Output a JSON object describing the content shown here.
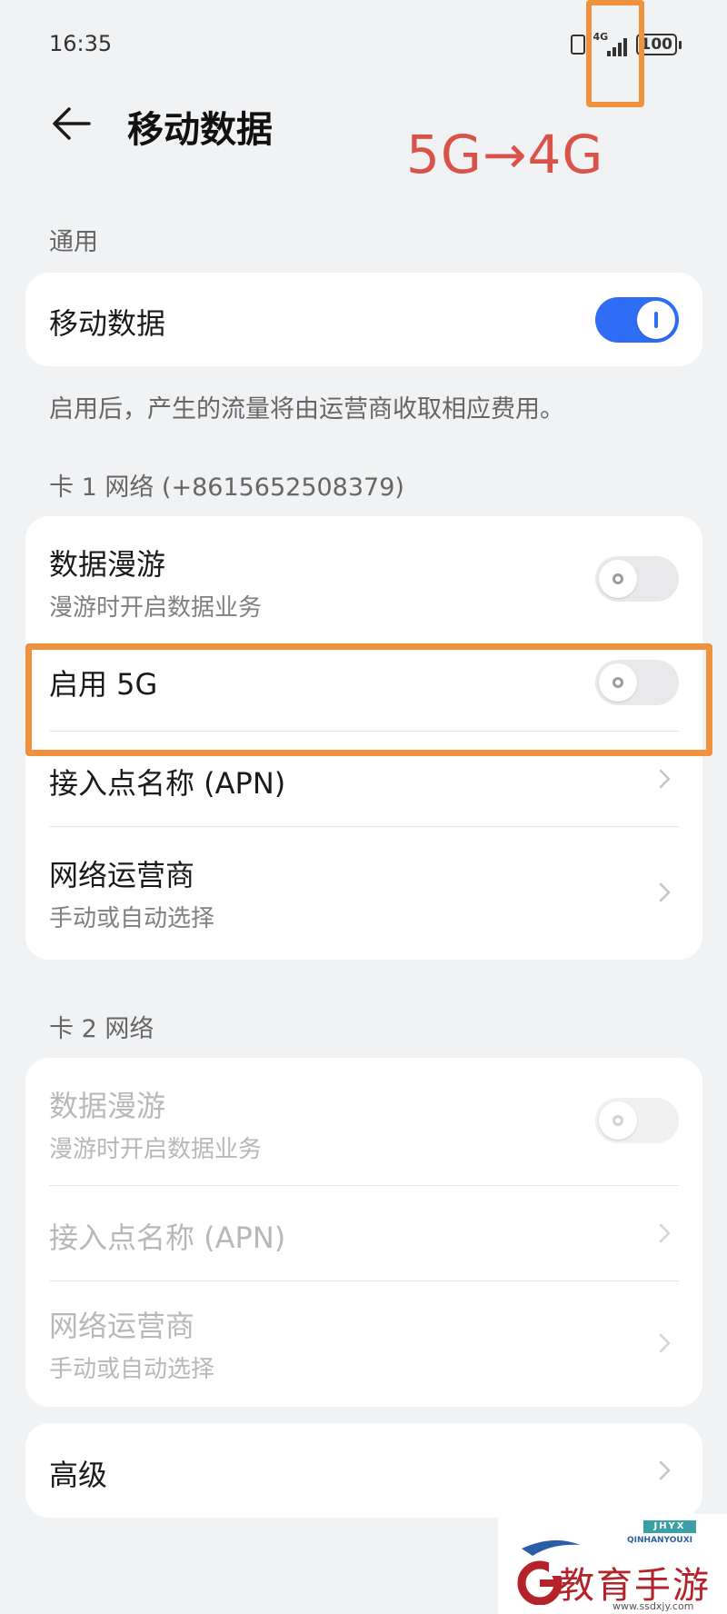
{
  "status_bar": {
    "time": "16:35",
    "network_label": "4G",
    "battery": "100"
  },
  "header": {
    "title": "移动数据"
  },
  "annotation": {
    "text": "5G→4G"
  },
  "general": {
    "label": "通用",
    "mobile_data": {
      "title": "移动数据",
      "enabled": true
    },
    "description": "启用后，产生的流量将由运营商收取相应费用。"
  },
  "card1": {
    "label": "卡 1 网络 (+8615652508379)",
    "roaming": {
      "title": "数据漫游",
      "subtitle": "漫游时开启数据业务",
      "enabled": false
    },
    "enable_5g": {
      "title": "启用 5G",
      "enabled": false
    },
    "apn": {
      "title": "接入点名称 (APN)"
    },
    "carrier": {
      "title": "网络运营商",
      "subtitle": "手动或自动选择"
    }
  },
  "card2": {
    "label": "卡 2 网络",
    "roaming": {
      "title": "数据漫游",
      "subtitle": "漫游时开启数据业务",
      "enabled": false
    },
    "apn": {
      "title": "接入点名称 (APN)"
    },
    "carrier": {
      "title": "网络运营商",
      "subtitle": "手动或自动选择"
    }
  },
  "advanced": {
    "title": "高级"
  },
  "watermark": {
    "tag": "JHYX",
    "subtitle": "QINHANYOUXI",
    "brand": "教育手游网",
    "url": "www.ssdxjy.com"
  },
  "colors": {
    "accent": "#2f6df6",
    "highlight": "#f0913e",
    "annotation": "#d9534a"
  }
}
